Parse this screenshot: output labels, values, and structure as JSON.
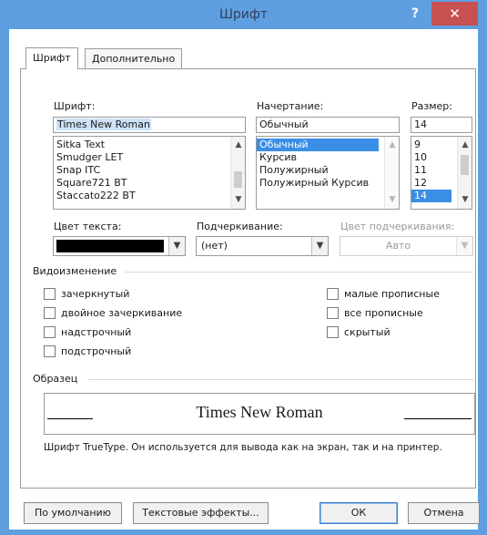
{
  "window": {
    "title": "Шрифт",
    "help_label": "?",
    "close_label": "✕"
  },
  "tabs": [
    {
      "label": "Шрифт",
      "active": true
    },
    {
      "label": "Дополнительно",
      "active": false
    }
  ],
  "font": {
    "label": "Шрифт:",
    "value": "Times New Roman",
    "items": [
      "Sitka Text",
      "Smudger LET",
      "Snap ITC",
      "Square721 BT",
      "Staccato222 BT"
    ]
  },
  "style": {
    "label": "Начертание:",
    "value": "Обычный",
    "items": [
      "Обычный",
      "Курсив",
      "Полужирный",
      "Полужирный Курсив"
    ],
    "selected_index": 0
  },
  "size": {
    "label": "Размер:",
    "value": "14",
    "items": [
      "9",
      "10",
      "11",
      "12",
      "14"
    ],
    "selected_index": 4
  },
  "font_color": {
    "label": "Цвет текста:",
    "color": "#000000"
  },
  "underline": {
    "label": "Подчеркивание:",
    "value": "(нет)"
  },
  "underline_color": {
    "label": "Цвет подчеркивания:",
    "value": "Авто"
  },
  "effects": {
    "label": "Видоизменение",
    "left": [
      {
        "label": "зачеркнутый",
        "checked": false
      },
      {
        "label": "двойное зачеркивание",
        "checked": false
      },
      {
        "label": "надстрочный",
        "checked": false
      },
      {
        "label": "подстрочный",
        "checked": false
      }
    ],
    "right": [
      {
        "label": "малые прописные",
        "checked": false
      },
      {
        "label": "все прописные",
        "checked": false
      },
      {
        "label": "скрытый",
        "checked": false
      }
    ]
  },
  "preview": {
    "label": "Образец",
    "text": "Times New Roman",
    "note": "Шрифт TrueType. Он используется для вывода как на экран, так и на принтер."
  },
  "buttons": {
    "default": "По умолчанию",
    "text_effects": "Текстовые эффекты...",
    "ok": "ОК",
    "cancel": "Отмена"
  },
  "colors": {
    "title_bar": "#5f9fe0",
    "close_button": "#c75050",
    "selection": "#3a8ee6"
  }
}
